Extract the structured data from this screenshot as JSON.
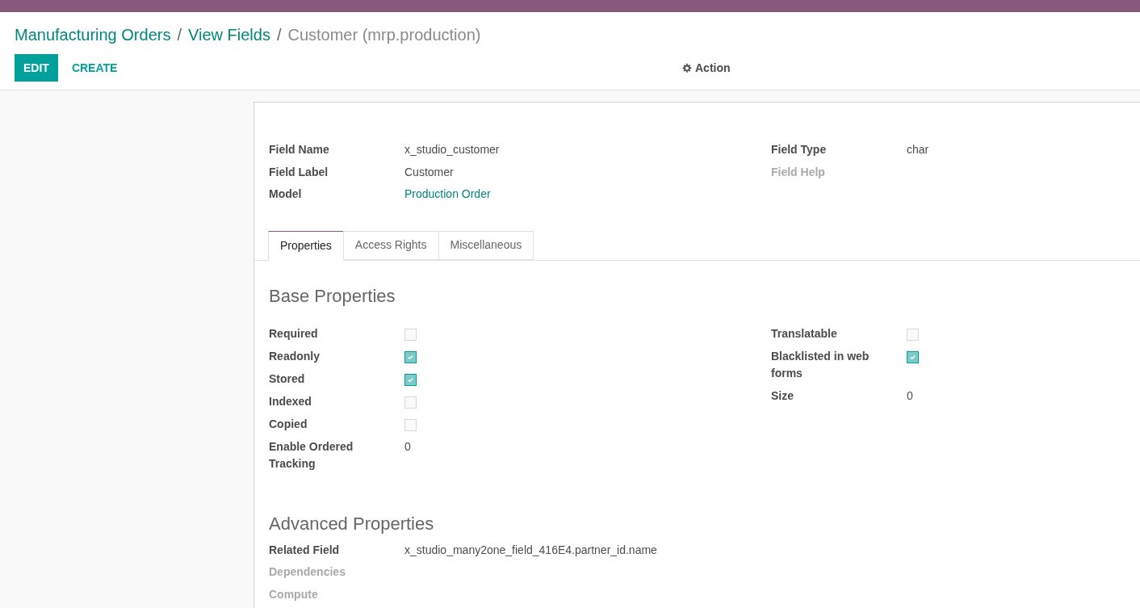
{
  "breadcrumbs": [
    {
      "label": "Manufacturing Orders",
      "kind": "link"
    },
    {
      "label": "/",
      "kind": "separator"
    },
    {
      "label": "View Fields",
      "kind": "link"
    },
    {
      "label": "/",
      "kind": "separator"
    },
    {
      "label": "Customer (mrp.production)",
      "kind": "current"
    }
  ],
  "buttons": [
    {
      "label": "EDIT",
      "kind": "primary"
    },
    {
      "label": "CREATE",
      "kind": "link"
    }
  ],
  "action": {
    "label": "Action"
  },
  "header_fields": {
    "left": [
      {
        "label": "Field Name",
        "value": "x_studio_customer",
        "kind": "text",
        "empty": false
      },
      {
        "label": "Field Label",
        "value": "Customer",
        "kind": "text",
        "empty": false
      },
      {
        "label": "Model",
        "value": "Production Order",
        "kind": "link",
        "empty": false
      }
    ],
    "right": [
      {
        "label": "Field Type",
        "value": "char",
        "kind": "text",
        "empty": false
      },
      {
        "label": "Field Help",
        "empty": true
      }
    ]
  },
  "tabs": [
    {
      "label": "Properties",
      "selected": true
    },
    {
      "label": "Access Rights",
      "selected": false
    },
    {
      "label": "Miscellaneous",
      "selected": false
    }
  ],
  "base_properties": {
    "title": "Base Properties",
    "left": [
      {
        "label": "Required",
        "kind": "checkbox",
        "checked": false
      },
      {
        "label": "Readonly",
        "kind": "checkbox",
        "checked": true
      },
      {
        "label": "Stored",
        "kind": "checkbox",
        "checked": true
      },
      {
        "label": "Indexed",
        "kind": "checkbox",
        "checked": false
      },
      {
        "label": "Copied",
        "kind": "checkbox",
        "checked": false
      },
      {
        "label": "Enable Ordered Tracking",
        "kind": "value",
        "value": "0"
      }
    ],
    "right": [
      {
        "label": "Translatable",
        "kind": "checkbox",
        "checked": false
      },
      {
        "label": "Blacklisted in web forms",
        "kind": "checkbox",
        "checked": true
      },
      {
        "label": "Size",
        "kind": "value",
        "value": "0"
      }
    ]
  },
  "advanced_properties": {
    "title": "Advanced Properties",
    "rows": [
      {
        "label": "Related Field",
        "value": "x_studio_many2one_field_416E4.partner_id.name",
        "empty": false
      },
      {
        "label": "Dependencies",
        "empty": true
      },
      {
        "label": "Compute",
        "empty": true
      }
    ]
  }
}
